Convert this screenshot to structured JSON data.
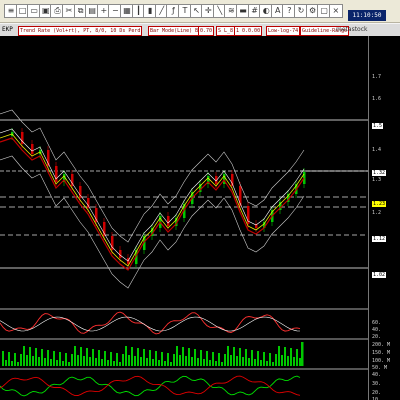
{
  "window": {
    "clock": "11:10:50",
    "brand": "metastock",
    "symbol": "EKP"
  },
  "toolbar_icons": [
    "list-icon",
    "new-icon",
    "open-icon",
    "save-icon",
    "print-icon",
    "cut-icon",
    "copy-icon",
    "paste-icon",
    "zoom-in-icon",
    "zoom-out-icon",
    "chart-icon",
    "bars-icon",
    "candle-icon",
    "line-icon",
    "indicator-icon",
    "text-icon",
    "pointer-icon",
    "crosshair-icon",
    "trendline-icon",
    "fib-icon",
    "ruler-icon",
    "grid-icon",
    "color-icon",
    "font-icon",
    "help-icon",
    "refresh-icon",
    "settings-icon",
    "window-icon",
    "close-icon"
  ],
  "captions": [
    "Trend Rate (Vol+rt), PT, 8/0, 10 Ds Perd",
    "Bar Mode(Line) Bank",
    "0.70",
    "S L_8",
    "1 0.0.00",
    "Low-log-74",
    "Guideline-Range"
  ],
  "price_scale": {
    "labels": [
      "1.7",
      "1.6",
      "1.5",
      "1.4",
      "1.32",
      "1.3",
      "1.23",
      "1.2",
      "1.12",
      "1.02"
    ],
    "highlight": "1.23",
    "boxed": [
      "1.5",
      "1.32",
      "1.12",
      "1.02"
    ]
  },
  "osc_scale": [
    "60.",
    "40.",
    "20."
  ],
  "volume_scale": [
    "200. M",
    "150. M",
    "100. M",
    "50. M"
  ],
  "dmi_scale": [
    "40.",
    "30.",
    "20.",
    "10."
  ],
  "colors": {
    "plot_bg": "#000000",
    "up": "#00c800",
    "down": "#d00000",
    "ma_red": "#c00000",
    "ma_yellow": "#e8e800",
    "band": "#cccccc",
    "highlight": "#ffff00"
  }
}
